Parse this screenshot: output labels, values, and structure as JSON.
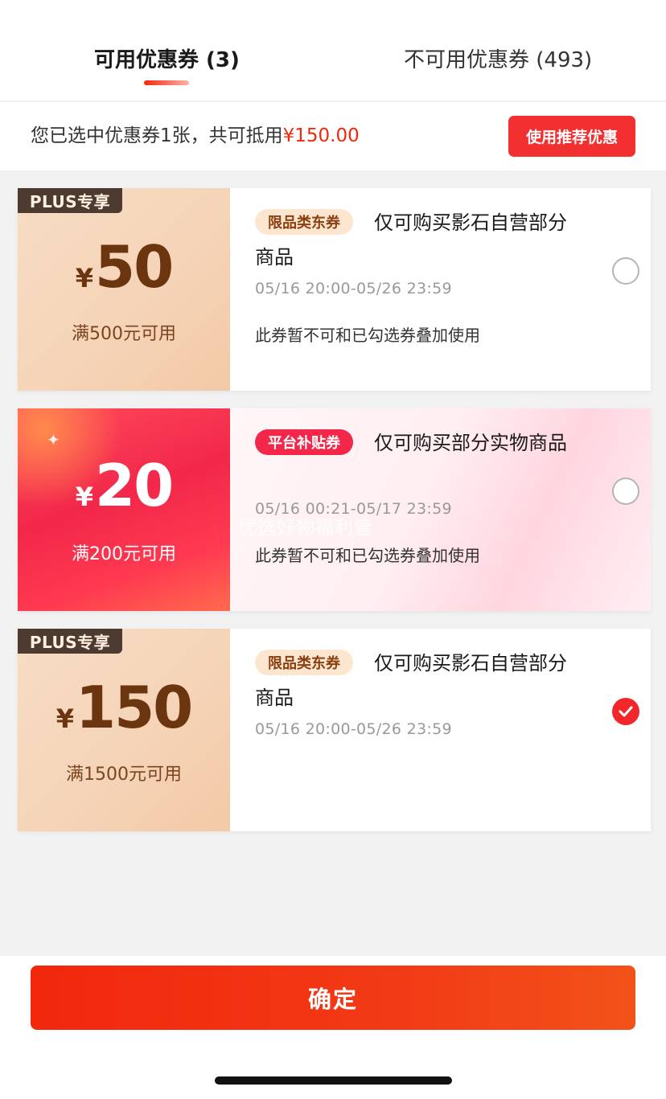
{
  "tabs": {
    "available": "可用优惠券 (3)",
    "unavailable": "不可用优惠券 (493)"
  },
  "summary": {
    "text_prefix": "您已选中优惠券1张，共可抵用",
    "amount": "¥150.00",
    "recommend_button": "使用推荐优惠"
  },
  "coupons": [
    {
      "plus_tag": "PLUS专享",
      "currency": "¥",
      "amount": "50",
      "threshold": "满500元可用",
      "badge": "限品类东券",
      "title": "仅可购买影石自营部分商品",
      "validity": "05/16 20:00-05/26 23:59",
      "note": "此券暂不可和已勾选券叠加使用",
      "selected": false
    },
    {
      "currency": "¥",
      "amount": "20",
      "threshold": "满200元可用",
      "badge": "平台补贴券",
      "title": "仅可购买部分实物商品",
      "validity": "05/16 00:21-05/17 23:59",
      "note": "此券暂不可和已勾选券叠加使用",
      "selected": false
    },
    {
      "plus_tag": "PLUS专享",
      "currency": "¥",
      "amount": "150",
      "threshold": "满1500元可用",
      "badge": "限品类东券",
      "title": "仅可购买影石自营部分商品",
      "validity": "05/16 20:00-05/26 23:59",
      "selected": true
    }
  ],
  "watermark": "优选好物福利管",
  "footer": {
    "confirm_button": "确定"
  },
  "colors": {
    "accent": "#f2270c",
    "plus_tag_bg": "#4d3a30",
    "plus_amount": "#6b3510",
    "check": "#f2272c"
  }
}
